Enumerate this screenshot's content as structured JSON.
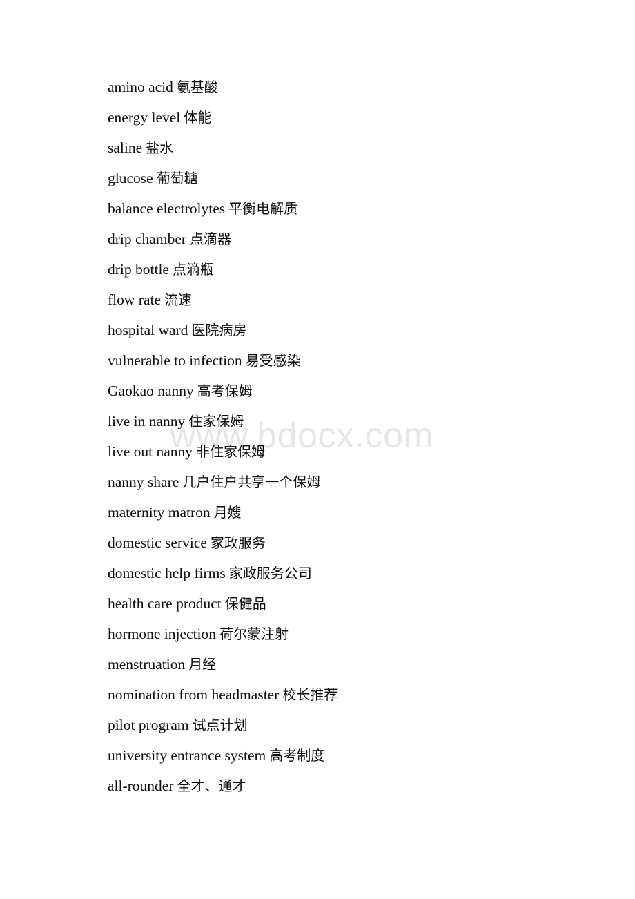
{
  "document": {
    "page_background": "#ffffff",
    "text_color": "#0d0d0d",
    "watermark": {
      "text": "www.bdocx.com",
      "color": "#e6e6e6"
    }
  },
  "vocab_list": [
    {
      "term": "amino acid",
      "gloss": "氨基酸"
    },
    {
      "term": "energy level",
      "gloss": "体能"
    },
    {
      "term": "saline",
      "gloss": "盐水"
    },
    {
      "term": "glucose",
      "gloss": "葡萄糖"
    },
    {
      "term": "balance electrolytes",
      "gloss": "平衡电解质"
    },
    {
      "term": "drip chamber",
      "gloss": "点滴器"
    },
    {
      "term": "drip bottle",
      "gloss": "点滴瓶"
    },
    {
      "term": "flow rate",
      "gloss": "流速"
    },
    {
      "term": "hospital ward",
      "gloss": "医院病房"
    },
    {
      "term": "vulnerable to infection",
      "gloss": "易受感染"
    },
    {
      "term": "Gaokao nanny",
      "gloss": "高考保姆"
    },
    {
      "term": "live in nanny",
      "gloss": "住家保姆"
    },
    {
      "term": "live out nanny",
      "gloss": "非住家保姆"
    },
    {
      "term": "nanny share",
      "gloss": "几户住户共享一个保姆"
    },
    {
      "term": "maternity matron",
      "gloss": "月嫂"
    },
    {
      "term": "domestic service",
      "gloss": "家政服务"
    },
    {
      "term": "domestic help firms",
      "gloss": "家政服务公司"
    },
    {
      "term": "health care product",
      "gloss": "保健品"
    },
    {
      "term": "hormone injection",
      "gloss": "荷尔蒙注射"
    },
    {
      "term": "menstruation",
      "gloss": "月经"
    },
    {
      "term": "nomination from headmaster",
      "gloss": "校长推荐"
    },
    {
      "term": "pilot program",
      "gloss": "试点计划"
    },
    {
      "term": "university entrance system",
      "gloss": "高考制度"
    },
    {
      "term": "all-rounder",
      "gloss": "全才、通才"
    }
  ]
}
